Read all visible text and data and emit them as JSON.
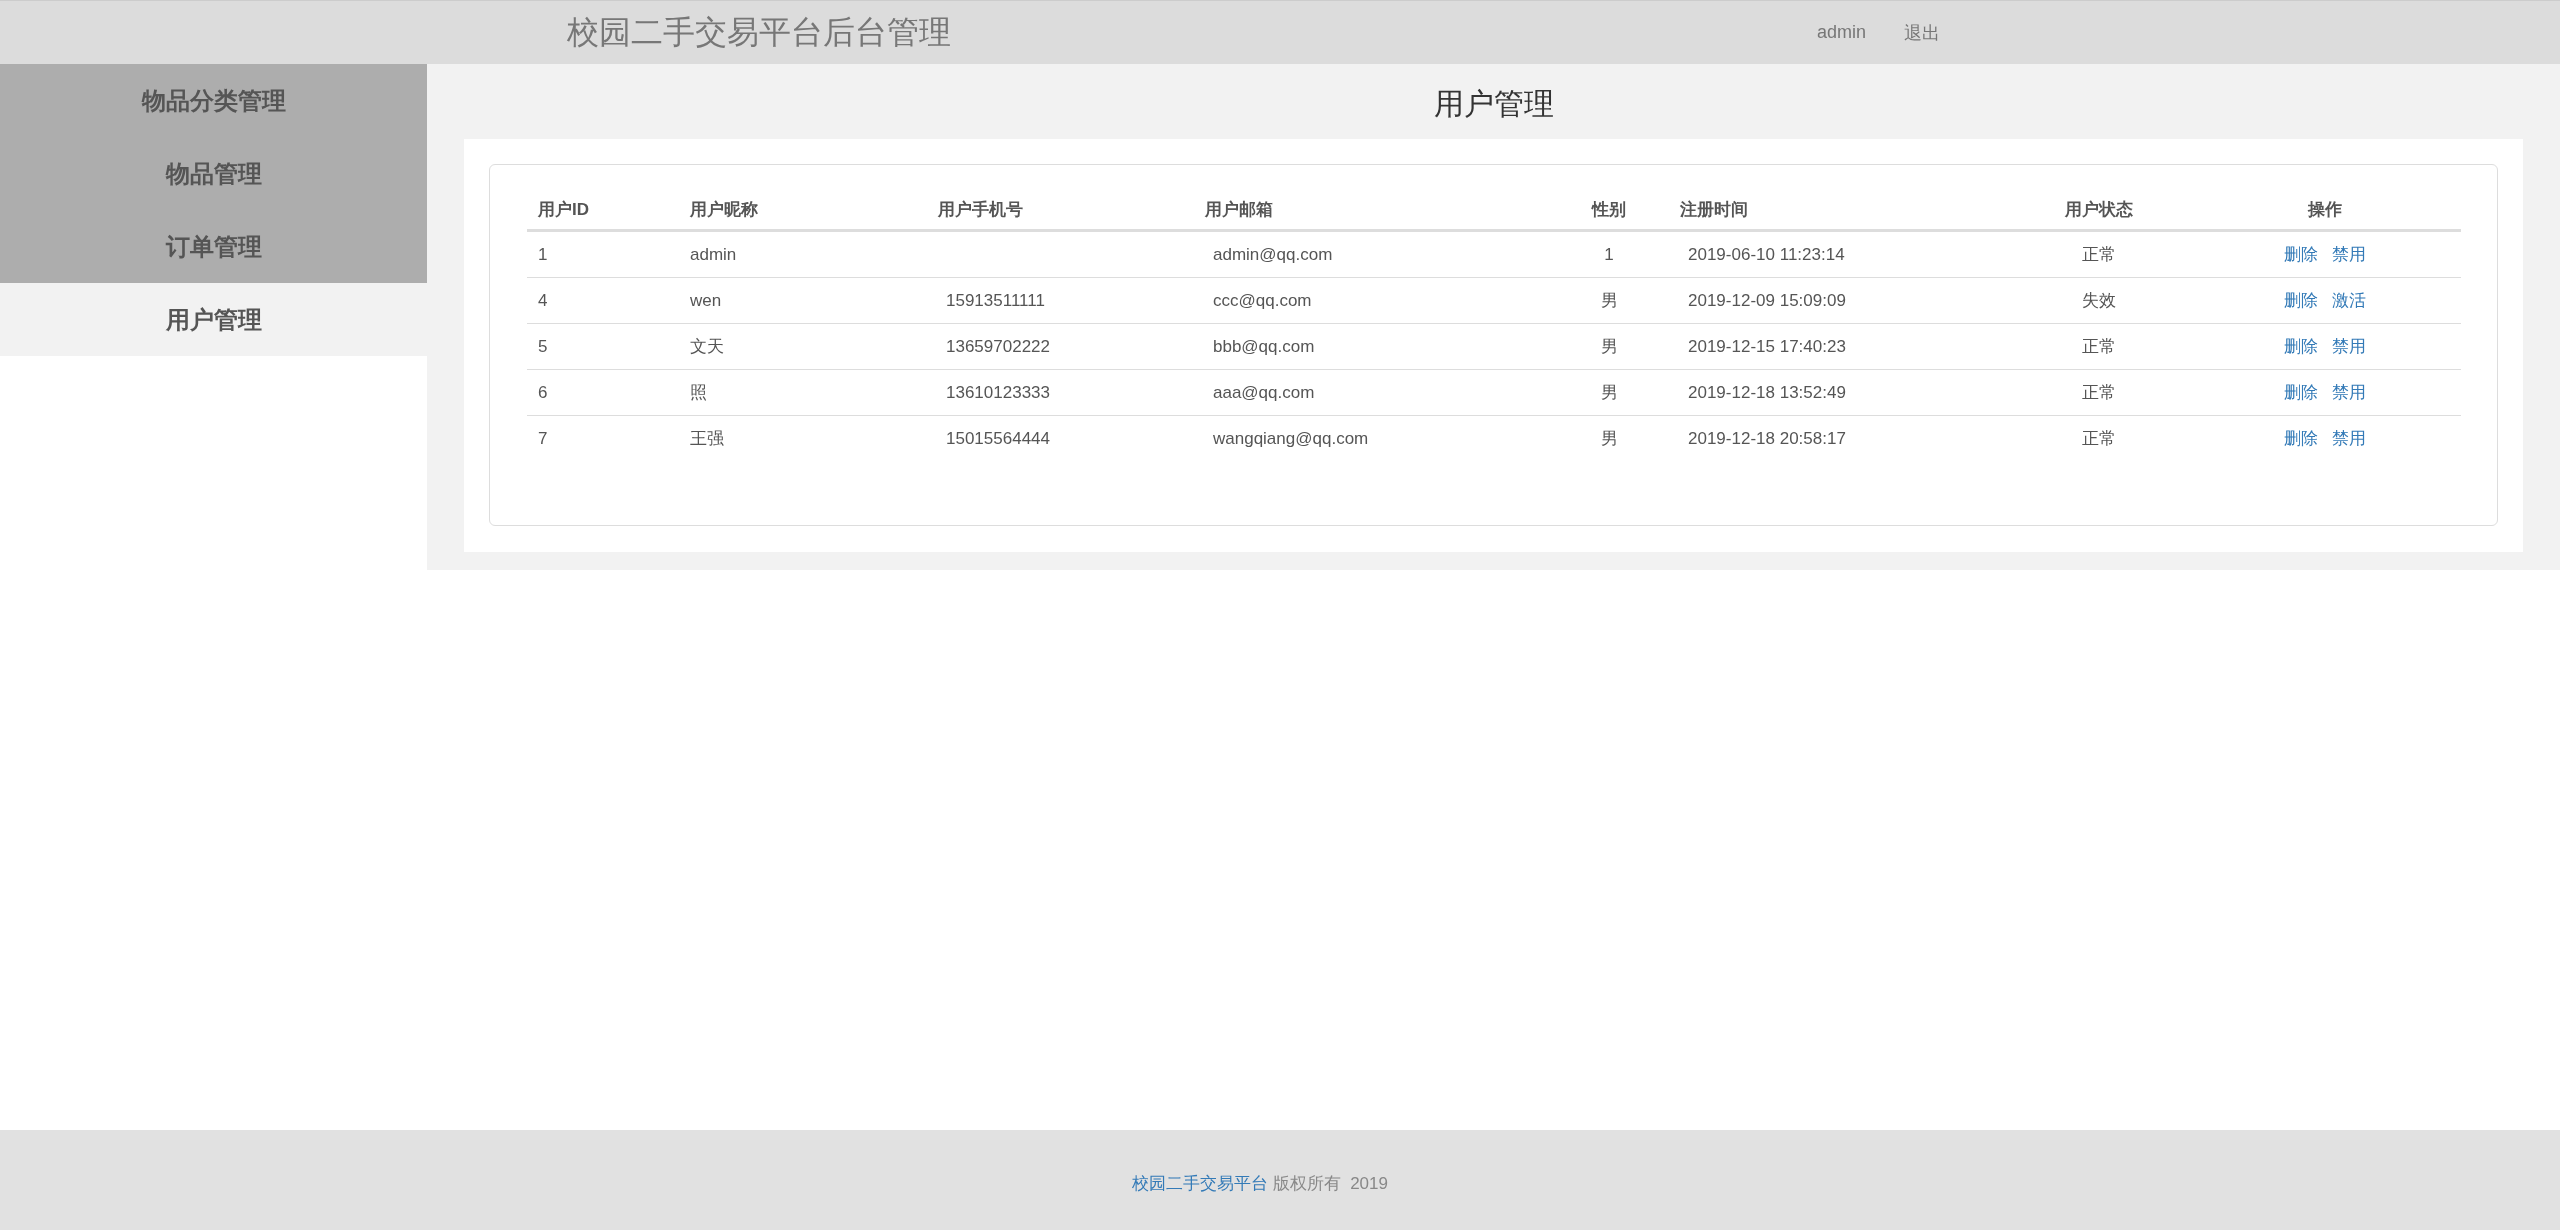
{
  "header": {
    "title": "校园二手交易平台后台管理",
    "user": "admin",
    "logout": "退出"
  },
  "sidebar": {
    "items": [
      {
        "label": "物品分类管理",
        "selected": false
      },
      {
        "label": "物品管理",
        "selected": false
      },
      {
        "label": "订单管理",
        "selected": false
      },
      {
        "label": "用户管理",
        "selected": true
      }
    ]
  },
  "page_title": "用户管理",
  "table": {
    "columns": [
      "用户ID",
      "用户昵称",
      "用户手机号",
      "用户邮箱",
      "性别",
      "注册时间",
      "用户状态",
      "操作"
    ],
    "rows": [
      {
        "id": "1",
        "nickname": "admin",
        "phone": "",
        "email": "admin@qq.com",
        "gender": "1",
        "registered": "2019-06-10 11:23:14",
        "status": "正常",
        "actions": [
          "删除",
          "禁用"
        ]
      },
      {
        "id": "4",
        "nickname": "wen",
        "phone": "15913511111",
        "email": "ccc@qq.com",
        "gender": "男",
        "registered": "2019-12-09 15:09:09",
        "status": "失效",
        "actions": [
          "删除",
          "激活"
        ]
      },
      {
        "id": "5",
        "nickname": "文天",
        "phone": "13659702222",
        "email": "bbb@qq.com",
        "gender": "男",
        "registered": "2019-12-15 17:40:23",
        "status": "正常",
        "actions": [
          "删除",
          "禁用"
        ]
      },
      {
        "id": "6",
        "nickname": "照",
        "phone": "13610123333",
        "email": "aaa@qq.com",
        "gender": "男",
        "registered": "2019-12-18 13:52:49",
        "status": "正常",
        "actions": [
          "删除",
          "禁用"
        ]
      },
      {
        "id": "7",
        "nickname": "王强",
        "phone": "15015564444",
        "email": "wangqiang@qq.com",
        "gender": "男",
        "registered": "2019-12-18 20:58:17",
        "status": "正常",
        "actions": [
          "删除",
          "禁用"
        ]
      }
    ]
  },
  "footer": {
    "site_link": "校园二手交易平台",
    "text": "版权所有  2019"
  }
}
